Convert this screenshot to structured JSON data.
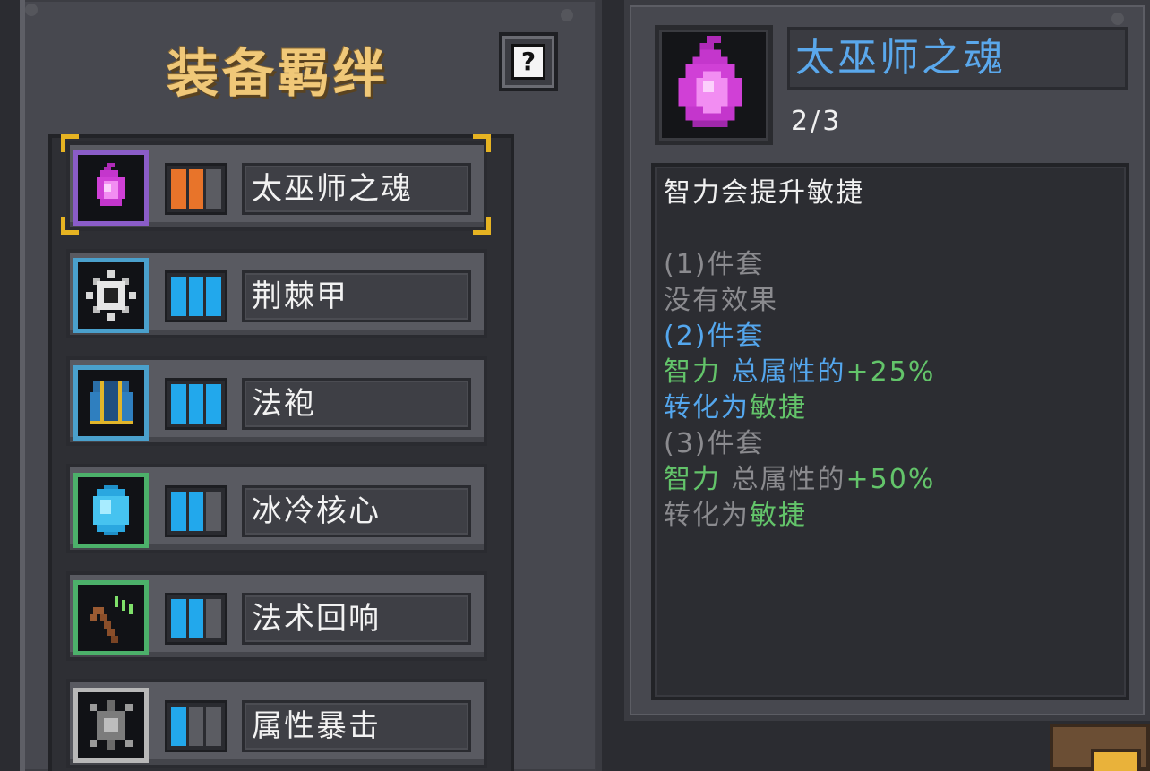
{
  "left_panel": {
    "title": "装备羁绊",
    "help_label": "?",
    "sets": [
      {
        "name": "太巫师之魂",
        "icon": "purple-flame-icon",
        "frame_color": "#8a5cc8",
        "pip_color": "#e8742a",
        "pips_filled": 2,
        "pips_total": 3,
        "selected": true
      },
      {
        "name": "荆棘甲",
        "icon": "spiked-gear-icon",
        "frame_color": "#4aa0cc",
        "pip_color": "#22a8ec",
        "pips_filled": 3,
        "pips_total": 3,
        "selected": false
      },
      {
        "name": "法袍",
        "icon": "robe-icon",
        "frame_color": "#4aa0cc",
        "pip_color": "#22a8ec",
        "pips_filled": 3,
        "pips_total": 3,
        "selected": false
      },
      {
        "name": "冰冷核心",
        "icon": "ice-crystal-icon",
        "frame_color": "#4cb06a",
        "pip_color": "#22a8ec",
        "pips_filled": 2,
        "pips_total": 3,
        "selected": false
      },
      {
        "name": "法术回响",
        "icon": "staff-icon",
        "frame_color": "#4cb06a",
        "pip_color": "#22a8ec",
        "pips_filled": 2,
        "pips_total": 3,
        "selected": false
      },
      {
        "name": "属性暴击",
        "icon": "shuriken-icon",
        "frame_color": "#b8b8b8",
        "pip_color": "#22a8ec",
        "pips_filled": 1,
        "pips_total": 3,
        "selected": false
      }
    ]
  },
  "detail": {
    "name": "太巫师之魂",
    "progress": "2/3",
    "icon": "purple-flame-icon",
    "description": [
      [
        {
          "t": "智力会提升敏捷",
          "c": "white"
        }
      ],
      [
        {
          "t": "",
          "c": "white"
        }
      ],
      [
        {
          "t": "(1)件套",
          "c": "gray"
        }
      ],
      [
        {
          "t": "没有效果",
          "c": "gray"
        }
      ],
      [
        {
          "t": "(2)件套",
          "c": "blue"
        }
      ],
      [
        {
          "t": "智力",
          "c": "green"
        },
        {
          "t": " 总属性的",
          "c": "blue"
        },
        {
          "t": "+25%",
          "c": "green"
        }
      ],
      [
        {
          "t": "转化为",
          "c": "blue"
        },
        {
          "t": "敏捷",
          "c": "green"
        }
      ],
      [
        {
          "t": "(3)件套",
          "c": "gray"
        }
      ],
      [
        {
          "t": "智力",
          "c": "green"
        },
        {
          "t": " 总属性的",
          "c": "gray"
        },
        {
          "t": "+50%",
          "c": "green"
        }
      ],
      [
        {
          "t": "转化为",
          "c": "gray"
        },
        {
          "t": "敏捷",
          "c": "green"
        }
      ]
    ]
  },
  "colors": {
    "title_gold": "#f0c878",
    "selection_corner": "#e6b322",
    "text_blue": "#54a7ee",
    "text_green": "#63c46a",
    "text_gray": "#8b8b8f"
  }
}
